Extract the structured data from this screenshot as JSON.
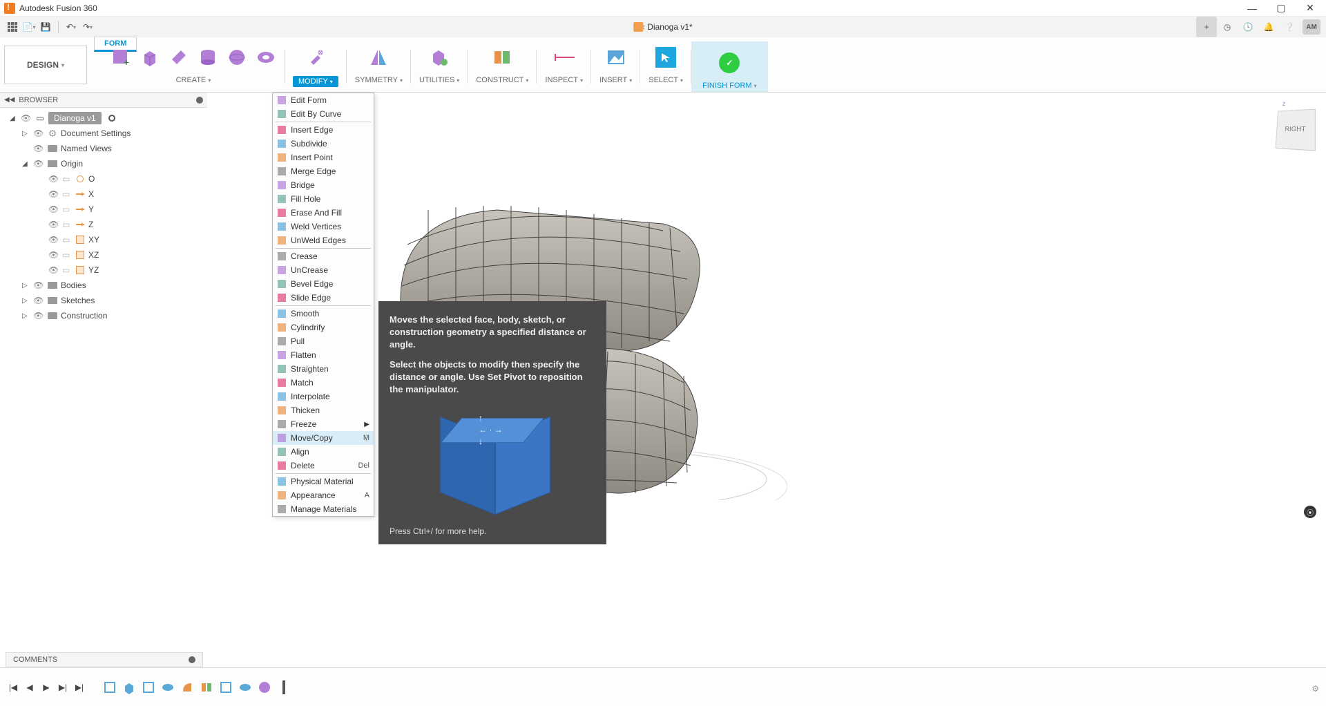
{
  "app": {
    "title": "Autodesk Fusion 360"
  },
  "doc": {
    "tab_title": "Dianoga v1*",
    "user_initials": "AM"
  },
  "workspace": {
    "label": "DESIGN"
  },
  "context_tab": "FORM",
  "ribbon": {
    "groups": [
      {
        "id": "create",
        "label": "CREATE"
      },
      {
        "id": "modify",
        "label": "MODIFY",
        "active": true
      },
      {
        "id": "symmetry",
        "label": "SYMMETRY"
      },
      {
        "id": "utilities",
        "label": "UTILITIES"
      },
      {
        "id": "construct",
        "label": "CONSTRUCT"
      },
      {
        "id": "inspect",
        "label": "INSPECT"
      },
      {
        "id": "insert",
        "label": "INSERT"
      },
      {
        "id": "select",
        "label": "SELECT"
      },
      {
        "id": "finish",
        "label": "FINISH FORM"
      }
    ]
  },
  "browser": {
    "header": "BROWSER",
    "root": "Dianoga v1",
    "items": [
      {
        "label": "Document Settings",
        "icon": "gear",
        "expand": "closed",
        "indent": 1
      },
      {
        "label": "Named Views",
        "icon": "folder",
        "indent": 1
      },
      {
        "label": "Origin",
        "icon": "folder",
        "expand": "open",
        "indent": 1
      },
      {
        "label": "O",
        "icon": "origin",
        "indent": 2
      },
      {
        "label": "X",
        "icon": "axis",
        "indent": 2
      },
      {
        "label": "Y",
        "icon": "axis",
        "indent": 2
      },
      {
        "label": "Z",
        "icon": "axis",
        "indent": 2
      },
      {
        "label": "XY",
        "icon": "plane",
        "indent": 2
      },
      {
        "label": "XZ",
        "icon": "plane",
        "indent": 2
      },
      {
        "label": "YZ",
        "icon": "plane",
        "indent": 2
      },
      {
        "label": "Bodies",
        "icon": "folder",
        "expand": "closed",
        "indent": 1
      },
      {
        "label": "Sketches",
        "icon": "folder",
        "expand": "closed",
        "indent": 1
      },
      {
        "label": "Construction",
        "icon": "folder",
        "expand": "closed",
        "indent": 1
      }
    ]
  },
  "modify_menu": {
    "items": [
      {
        "label": "Edit Form"
      },
      {
        "label": "Edit By Curve"
      },
      {
        "divider": true
      },
      {
        "label": "Insert Edge"
      },
      {
        "label": "Subdivide"
      },
      {
        "label": "Insert Point"
      },
      {
        "label": "Merge Edge"
      },
      {
        "label": "Bridge"
      },
      {
        "label": "Fill Hole"
      },
      {
        "label": "Erase And Fill"
      },
      {
        "label": "Weld Vertices"
      },
      {
        "label": "UnWeld Edges"
      },
      {
        "divider": true
      },
      {
        "label": "Crease"
      },
      {
        "label": "UnCrease"
      },
      {
        "label": "Bevel Edge"
      },
      {
        "label": "Slide Edge"
      },
      {
        "divider": true
      },
      {
        "label": "Smooth"
      },
      {
        "label": "Cylindrify"
      },
      {
        "label": "Pull"
      },
      {
        "label": "Flatten"
      },
      {
        "label": "Straighten"
      },
      {
        "label": "Match"
      },
      {
        "label": "Interpolate"
      },
      {
        "label": "Thicken"
      },
      {
        "label": "Freeze",
        "submenu": true
      },
      {
        "label": "Move/Copy",
        "shortcut": "M",
        "hover": true,
        "more": true
      },
      {
        "label": "Align"
      },
      {
        "label": "Delete",
        "shortcut": "Del"
      },
      {
        "divider": true
      },
      {
        "label": "Physical Material"
      },
      {
        "label": "Appearance",
        "shortcut": "A"
      },
      {
        "label": "Manage Materials"
      }
    ]
  },
  "tooltip": {
    "p1": "Moves the selected face, body, sketch, or construction geometry a specified distance or angle.",
    "p2": "Select the objects to modify then specify the distance or angle. Use Set Pivot to reposition the manipulator.",
    "footer": "Press Ctrl+/ for more help."
  },
  "comments": {
    "header": "COMMENTS"
  },
  "viewcube": {
    "face": "RIGHT"
  }
}
